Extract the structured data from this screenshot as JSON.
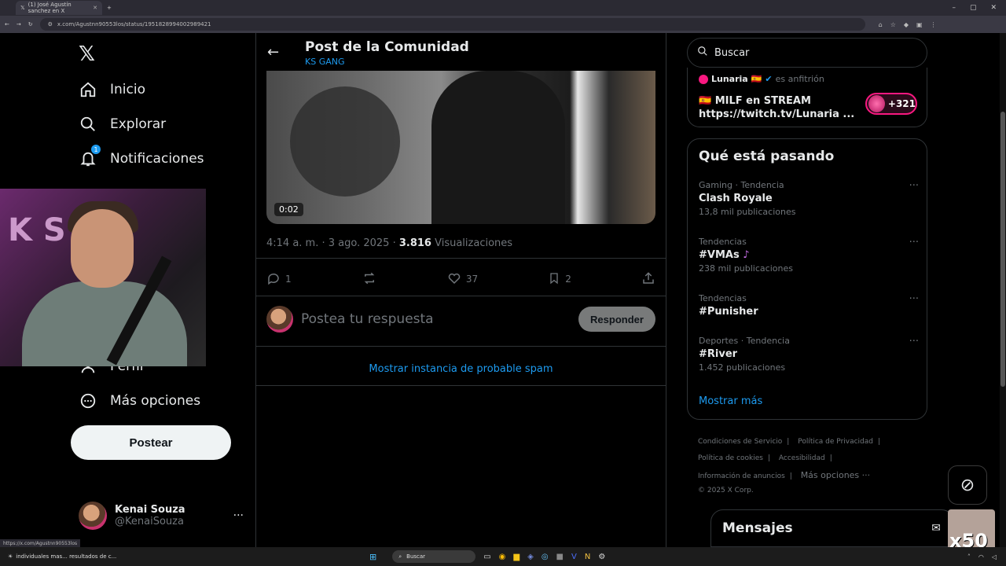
{
  "browser": {
    "tab_title": "(1) José Agustín sanchez en X",
    "url": "x.com/Agustnn90553los/status/1951828994002989421"
  },
  "nav": {
    "items": [
      {
        "label": "Inicio",
        "icon": "home-icon"
      },
      {
        "label": "Explorar",
        "icon": "search-icon"
      },
      {
        "label": "Notificaciones",
        "icon": "bell-icon",
        "badge": "1"
      },
      {
        "label": "Perfil",
        "icon": "person-icon"
      },
      {
        "label": "Más opciones",
        "icon": "more-circle-icon"
      }
    ],
    "post_button": "Postear"
  },
  "profile": {
    "name": "Kenai Souza",
    "handle": "@KenaiSouza"
  },
  "header": {
    "title": "Post de la Comunidad",
    "subtitle": "KS GANG"
  },
  "post": {
    "video_time": "0:02",
    "timestamp": "4:14 a. m. · 3 ago. 2025 · ",
    "views": "3.816",
    "views_label": " Visualizaciones",
    "replies": "1",
    "likes": "37",
    "bookmarks": "2"
  },
  "reply": {
    "placeholder": "Postea tu respuesta",
    "button": "Responder"
  },
  "spam_link": "Mostrar instancia de probable spam",
  "search": {
    "placeholder": "Buscar"
  },
  "space": {
    "host": "Lunaria",
    "host_suffix": "es anfitrión",
    "title_line1": "MILF en STREAM",
    "title_line2": "https://twitch.tv/Lunaria ...",
    "listeners": "+321"
  },
  "trends": {
    "heading": "Qué está pasando",
    "items": [
      {
        "category": "Gaming · Tendencia",
        "name": "Clash Royale",
        "count": "13,8 mil publicaciones"
      },
      {
        "category": "Tendencias",
        "name": "#VMAs",
        "count": "238 mil publicaciones"
      },
      {
        "category": "Tendencias",
        "name": "#Punisher",
        "count": ""
      },
      {
        "category": "Deportes · Tendencia",
        "name": "#River",
        "count": "1.452 publicaciones"
      }
    ],
    "show_more": "Mostrar más"
  },
  "footer": {
    "terms": "Condiciones de Servicio",
    "privacy": "Política de Privacidad",
    "cookies": "Política de cookies",
    "accessibility": "Accesibilidad",
    "ads": "Información de anuncios",
    "more": "Más opciones ···",
    "copyright": "© 2025 X Corp."
  },
  "messages": {
    "label": "Mensajes"
  },
  "overlay": {
    "emote_text": "x50"
  },
  "status_url": "https://x.com/Agustnn90553los",
  "taskbar": {
    "search": "Buscar",
    "notification": "individuales mas... resultados de c..."
  }
}
